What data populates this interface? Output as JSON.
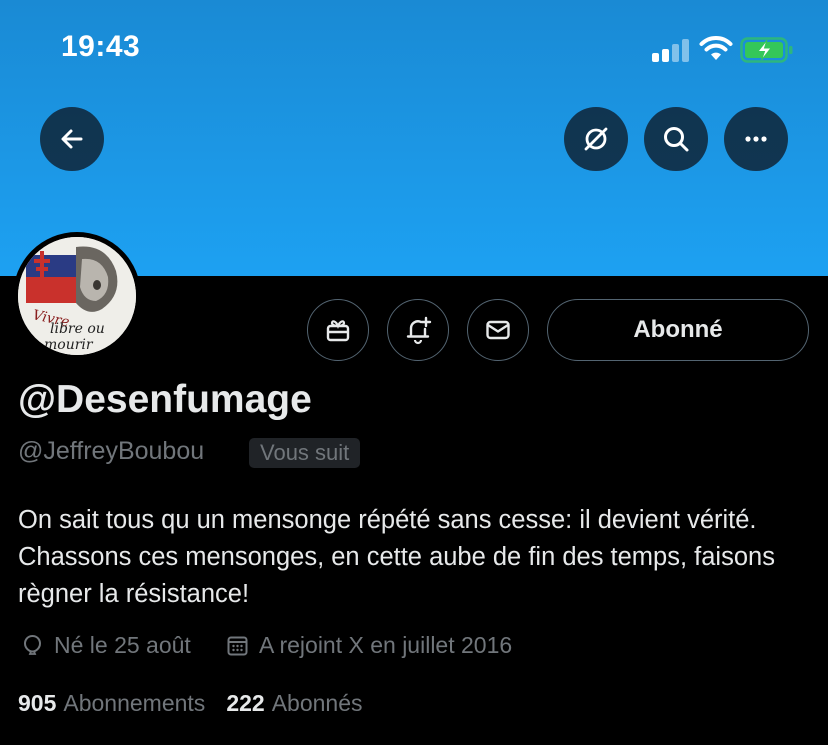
{
  "status_bar": {
    "time": "19:43",
    "icons": [
      "cellular-signal-icon",
      "wifi-icon",
      "battery-charging-icon"
    ]
  },
  "colors": {
    "banner": "#1da1f2",
    "background": "#000000",
    "primary_text": "#e7e9ea",
    "secondary_text": "#71767b",
    "button_border": "#536471",
    "battery_green": "#34c759"
  },
  "header_buttons": {
    "back_icon": "arrow-left-icon",
    "grok_icon": "grok-icon",
    "search_icon": "search-icon",
    "more_icon": "more-icon"
  },
  "profile": {
    "display_name": "@Desenfumage",
    "handle": "@JeffreyBoubou",
    "follows_you_badge": "Vous suit",
    "bio": "On sait tous qu un mensonge répété sans cesse: il devient vérité. Chassons ces mensonges, en cette aube de fin des temps, faisons règner la résistance!",
    "birthday": "Né le 25 août",
    "joined": "A rejoint X en juillet 2016",
    "avatar_text": "Vivre libre ou mourir"
  },
  "actions": {
    "gift_icon": "gift-icon",
    "notify_icon": "bell-plus-icon",
    "message_icon": "envelope-icon",
    "follow_label": "Abonné"
  },
  "stats": {
    "following_count": "905",
    "following_label": "Abonnements",
    "followers_count": "222",
    "followers_label": "Abonnés"
  }
}
